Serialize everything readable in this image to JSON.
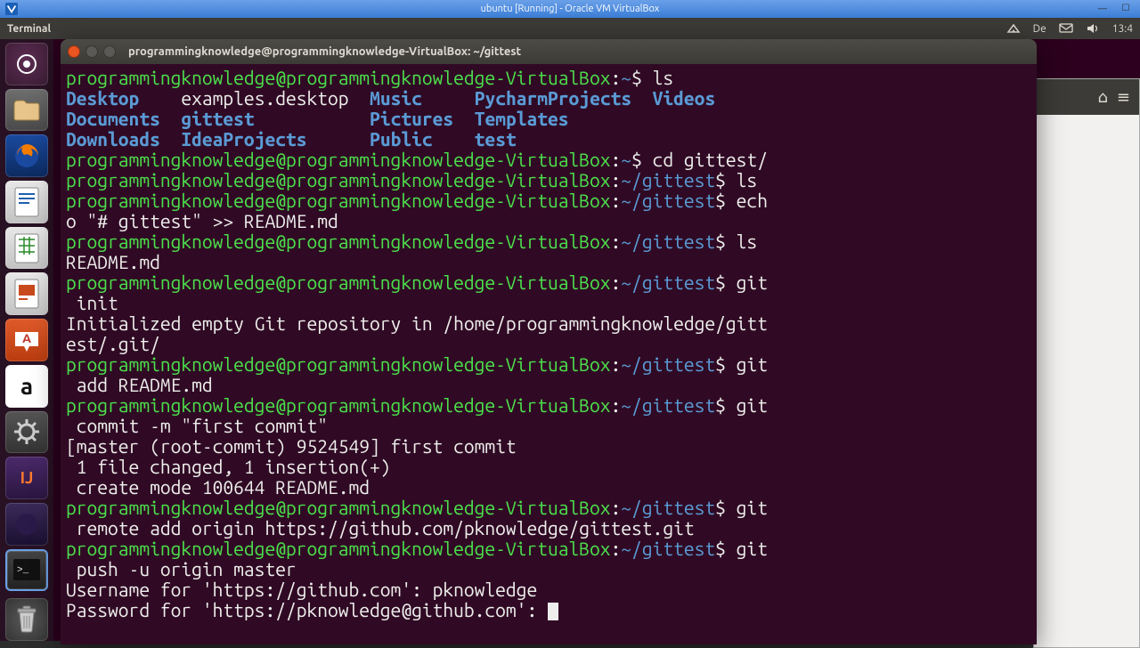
{
  "vbox": {
    "title": "ubuntu [Running] - Oracle VM VirtualBox"
  },
  "panel": {
    "app_title": "Terminal",
    "lang": "De",
    "time": "13:4"
  },
  "launcher": {
    "dash": "◌",
    "files": "📁",
    "firefox": "🦊",
    "writer": "≡",
    "calc": "▦",
    "impress": "▭",
    "software": "A",
    "amazon": "a",
    "settings": "⚙",
    "intellij": "IJ",
    "eclipse": "◑",
    "terminal": ">_",
    "trash": "🗑"
  },
  "nautilus": {
    "home_icon": "⌂",
    "menu_icon": "≡"
  },
  "terminal": {
    "title": "programmingknowledge@programmingknowledge-VirtualBox: ~/gittest",
    "prompt_user_host": "programmingknowledge@programmingknowledge-VirtualBox",
    "path_home": "~",
    "path_gittest": "~/gittest",
    "dollar": "$",
    "cmd_ls": "ls",
    "ls_row1": {
      "c1": "Desktop",
      "c2": "examples.desktop",
      "c3": "Music",
      "c4": "PycharmProjects",
      "c5": "Videos"
    },
    "ls_row2": {
      "c1": "Documents",
      "c2": "gittest",
      "c3": "Pictures",
      "c4": "Templates"
    },
    "ls_row3": {
      "c1": "Downloads",
      "c2": "IdeaProjects",
      "c3": "Public",
      "c4": "test"
    },
    "cmd_cd": "cd gittest/",
    "cmd_ls2": "ls",
    "cmd_echo_a": "ech",
    "cmd_echo_b": "o \"# gittest\" >> README.md",
    "cmd_ls3": "ls",
    "ls3_out": "README.md",
    "cmd_git_init_a": "git",
    "cmd_git_init_b": " init",
    "init_out_a": "Initialized empty Git repository in /home/programmingknowledge/gitt",
    "init_out_b": "est/.git/",
    "cmd_git_add_a": "git",
    "cmd_git_add_b": " add README.md",
    "cmd_git_commit_a": "git",
    "cmd_git_commit_b": " commit -m \"first commit\"",
    "commit_out1": "[master (root-commit) 9524549] first commit",
    "commit_out2": " 1 file changed, 1 insertion(+)",
    "commit_out3": " create mode 100644 README.md",
    "cmd_git_remote_a": "git",
    "cmd_git_remote_b": " remote add origin https://github.com/pknowledge/gittest.git",
    "cmd_git_push_a": "git",
    "cmd_git_push_b": " push -u origin master",
    "push_user": "Username for 'https://github.com': pknowledge",
    "push_pass": "Password for 'https://pknowledge@github.com': "
  }
}
